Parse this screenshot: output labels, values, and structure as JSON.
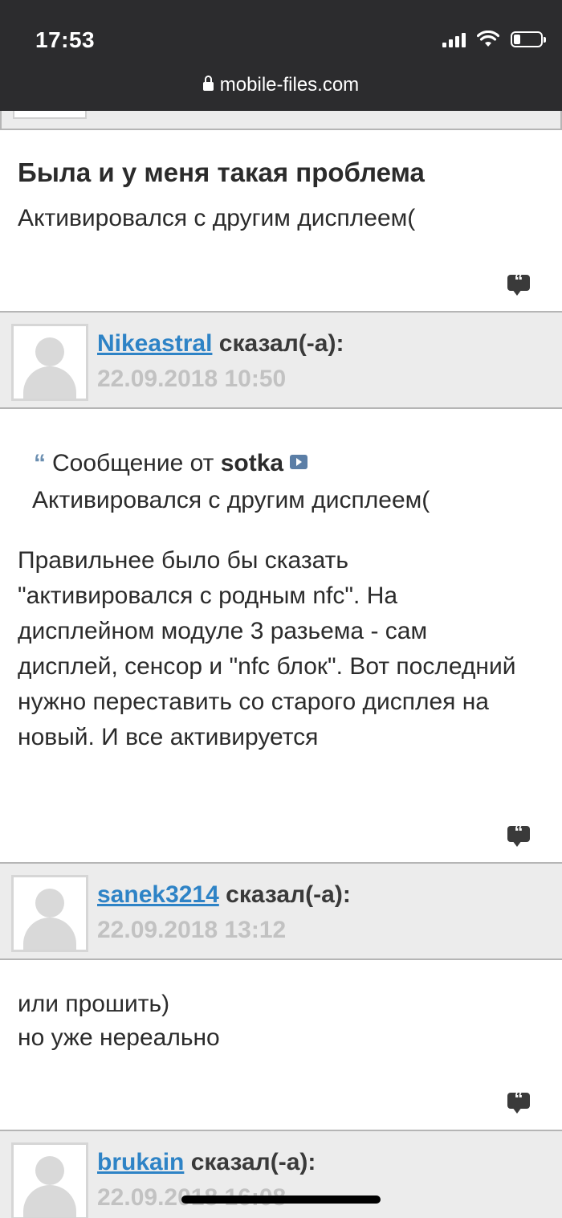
{
  "status_bar": {
    "time": "17:53"
  },
  "browser": {
    "url": "mobile-files.com"
  },
  "posts": [
    {
      "title": "Была и у меня такая проблема",
      "body": "Активировался с другим дисплеем("
    },
    {
      "username": "Nikeastral",
      "said": "сказал(-а):",
      "date": "22.09.2018 10:50",
      "quote": {
        "prefix": "Сообщение от",
        "author": "sotka",
        "text": "Активировался с другим дисплеем("
      },
      "body": "Правильнее было бы сказать \"активировался с родным nfc\". На дисплейном модуле 3 разьема - сам дисплей, сенсор и \"nfc блок\". Вот последний нужно переставить со старого дисплея на новый. И все активируется"
    },
    {
      "username": "sanek3214",
      "said": "сказал(-а):",
      "date": "22.09.2018 13:12",
      "body_lines": [
        "или прошить)",
        "но уже нереально"
      ]
    },
    {
      "username": "brukain",
      "said": "сказал(-а):",
      "date": "22.09.2018 16:08"
    }
  ],
  "icons": {
    "quote_button": "quote-bubble-icon",
    "avatar": "default-avatar-icon"
  },
  "colors": {
    "link": "#2e83c6",
    "date": "#c2c2c2",
    "header_bg": "#ececec",
    "topbar": "#2c2c2e"
  }
}
